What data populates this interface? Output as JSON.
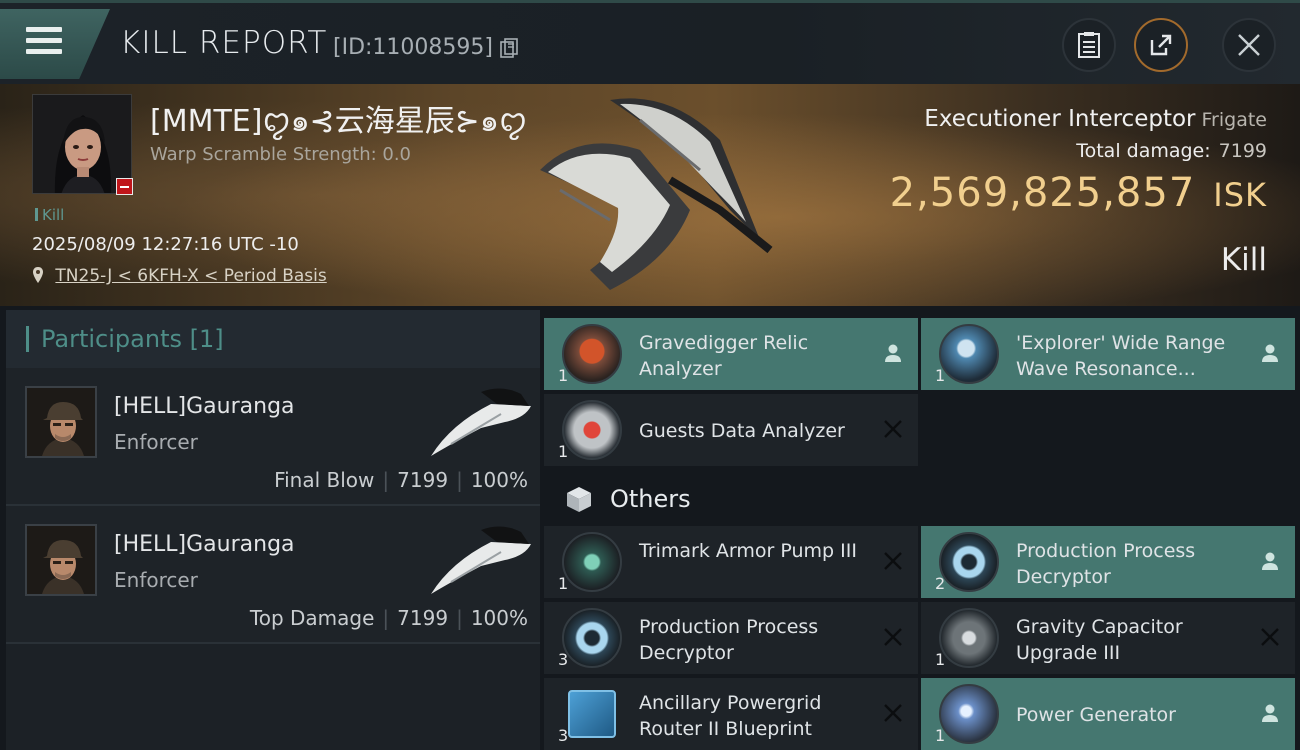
{
  "header": {
    "title": "KILL REPORT",
    "report_id": "[ID:11008595]",
    "icons": [
      "menu-icon",
      "copy-icon",
      "clipboard-icon",
      "share-icon",
      "close-icon"
    ]
  },
  "victim": {
    "name": "[MMTE]ꨄ๑⊰云海星辰⊱๑ꨄ",
    "warp_scramble": "Warp Scramble Strength: 0.0",
    "kill_tag": "Kill",
    "datetime": "2025/08/09 12:27:16 UTC -10",
    "location": "TN25-J < 6KFH-X < Period Basis",
    "ship_name": "Executioner Interceptor",
    "ship_class": "Frigate",
    "total_damage_label": "Total damage:",
    "total_damage": "7199",
    "isk_value": "2,569,825,857",
    "isk_unit": "ISK",
    "result": "Kill"
  },
  "participants": {
    "title": "Participants [1]",
    "rows": [
      {
        "name": "[HELL]Gauranga",
        "ship": "Enforcer",
        "tag": "Final Blow",
        "damage": "7199",
        "percent": "100%"
      },
      {
        "name": "[HELL]Gauranga",
        "ship": "Enforcer",
        "tag": "Top Damage",
        "damage": "7199",
        "percent": "100%"
      }
    ]
  },
  "items": {
    "fitted": [
      {
        "name": "Gravedigger Relic Analyzer",
        "qty": "1",
        "status": "dropped"
      },
      {
        "name": "'Explorer' Wide Range Wave Resonance...",
        "qty": "1",
        "status": "dropped"
      },
      {
        "name": "Guests Data Analyzer",
        "qty": "1",
        "status": "destroyed"
      }
    ],
    "others_title": "Others",
    "others": [
      {
        "name": "Trimark Armor Pump III",
        "qty": "1",
        "status": "destroyed"
      },
      {
        "name": "Production Process Decryptor",
        "qty": "2",
        "status": "dropped"
      },
      {
        "name": "Production Process Decryptor",
        "qty": "3",
        "status": "destroyed"
      },
      {
        "name": "Gravity Capacitor Upgrade III",
        "qty": "1",
        "status": "destroyed"
      },
      {
        "name": "Ancillary Powergrid Router II Blueprint",
        "qty": "3",
        "status": "destroyed"
      },
      {
        "name": "Power Generator",
        "qty": "1",
        "status": "dropped"
      }
    ]
  },
  "colors": {
    "accent_teal": "#457770",
    "isk_gold": "#f1cf8e",
    "destroyed_x": "#0b0d0f"
  }
}
